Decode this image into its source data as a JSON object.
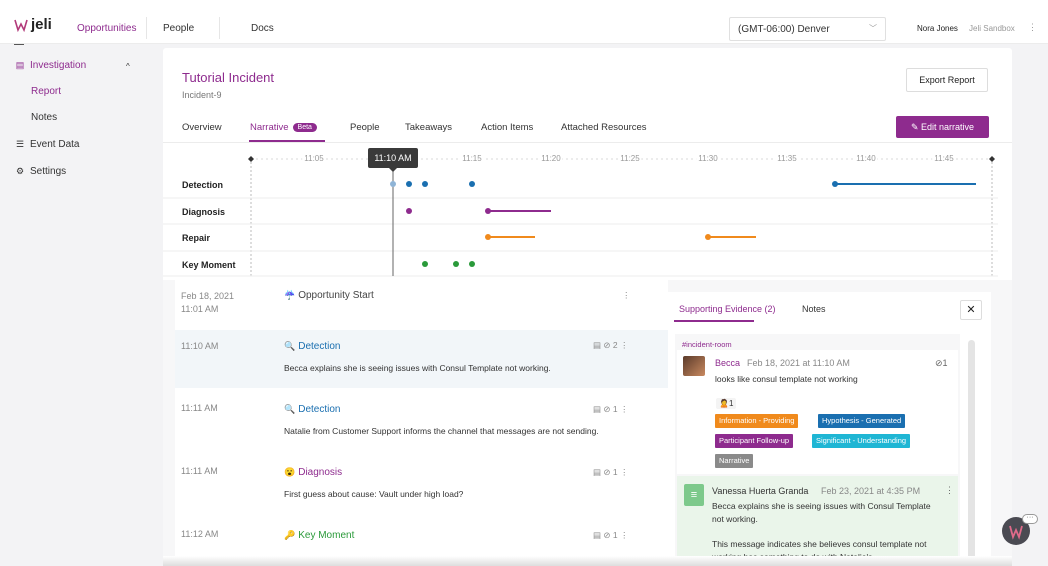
{
  "topnav": {
    "logo": "jeli",
    "nav": [
      "Opportunities",
      "People",
      "Docs"
    ],
    "timezone": "(GMT-06:00) Denver",
    "user": "Nora Jones",
    "org": "Jeli Sandbox"
  },
  "sidebar": {
    "investigation": "Investigation",
    "report": "Report",
    "notes": "Notes",
    "event_data": "Event Data",
    "settings": "Settings"
  },
  "incident": {
    "title": "Tutorial Incident",
    "id": "Incident-9",
    "export_label": "Export Report",
    "edit_label": "Edit narrative",
    "beta": "Beta"
  },
  "tabs": [
    "Overview",
    "Narrative",
    "People",
    "Takeaways",
    "Action Items",
    "Attached Resources"
  ],
  "timeline": {
    "ticks": [
      "11:05",
      "11:10",
      "11:15",
      "11:20",
      "11:25",
      "11:30",
      "11:35",
      "11:40",
      "11:45"
    ],
    "cursor_label": "11:10 AM",
    "rows": [
      "Detection",
      "Diagnosis",
      "Repair",
      "Key Moment"
    ],
    "colors": {
      "Detection": "#1a6fb0",
      "Diagnosis": "#8e2b8e",
      "Repair": "#f08a1c",
      "Key Moment": "#2a9a3a"
    }
  },
  "narrative": [
    {
      "time": "Feb 18, 2021",
      "time2": "11:01 AM",
      "emoji": "☔",
      "type": "Opportunity Start",
      "text": "",
      "evidence": "",
      "links": ""
    },
    {
      "time": "11:10 AM",
      "emoji": "🔍",
      "type": "Detection",
      "text": "Becca explains she is seeing issues with Consul Template not working.",
      "evidence": "2",
      "links": ""
    },
    {
      "time": "11:11 AM",
      "emoji": "🔍",
      "type": "Detection",
      "text": "Natalie from Customer Support informs the channel that messages are not sending.",
      "evidence": "1",
      "links": ""
    },
    {
      "time": "11:11 AM",
      "emoji": "😮",
      "type": "Diagnosis",
      "text": "First guess about cause: Vault under high load?",
      "evidence": "1",
      "links": ""
    },
    {
      "time": "11:12 AM",
      "emoji": "🔑",
      "type": "Key Moment",
      "text": "",
      "evidence": "1",
      "links": ""
    }
  ],
  "evidence": {
    "tab_supporting": "Supporting Evidence (2)",
    "tab_notes": "Notes",
    "channel": "#incident-room",
    "msg1": {
      "name": "Becca",
      "date": "Feb 18, 2021 at 11:10 AM",
      "links": "1",
      "text": "looks like consul template not working",
      "reaction": "1",
      "tags": [
        {
          "label": "Information - Providing",
          "color": "#f08a1c"
        },
        {
          "label": "Hypothesis - Generated",
          "color": "#1a6fb0"
        },
        {
          "label": "Participant Follow-up",
          "color": "#8e2b8e"
        },
        {
          "label": "Significant - Understanding",
          "color": "#1fb6d4"
        },
        {
          "label": "Narrative",
          "color": "#8a8a8a"
        }
      ]
    },
    "msg2": {
      "name": "Vanessa Huerta Granda",
      "date": "Feb 23, 2021 at 4:35 PM",
      "text": "Becca explains she is seeing issues with Consul Template not working.",
      "text2": "This message indicates she believes consul template not working has something to do with Natalie's"
    }
  }
}
